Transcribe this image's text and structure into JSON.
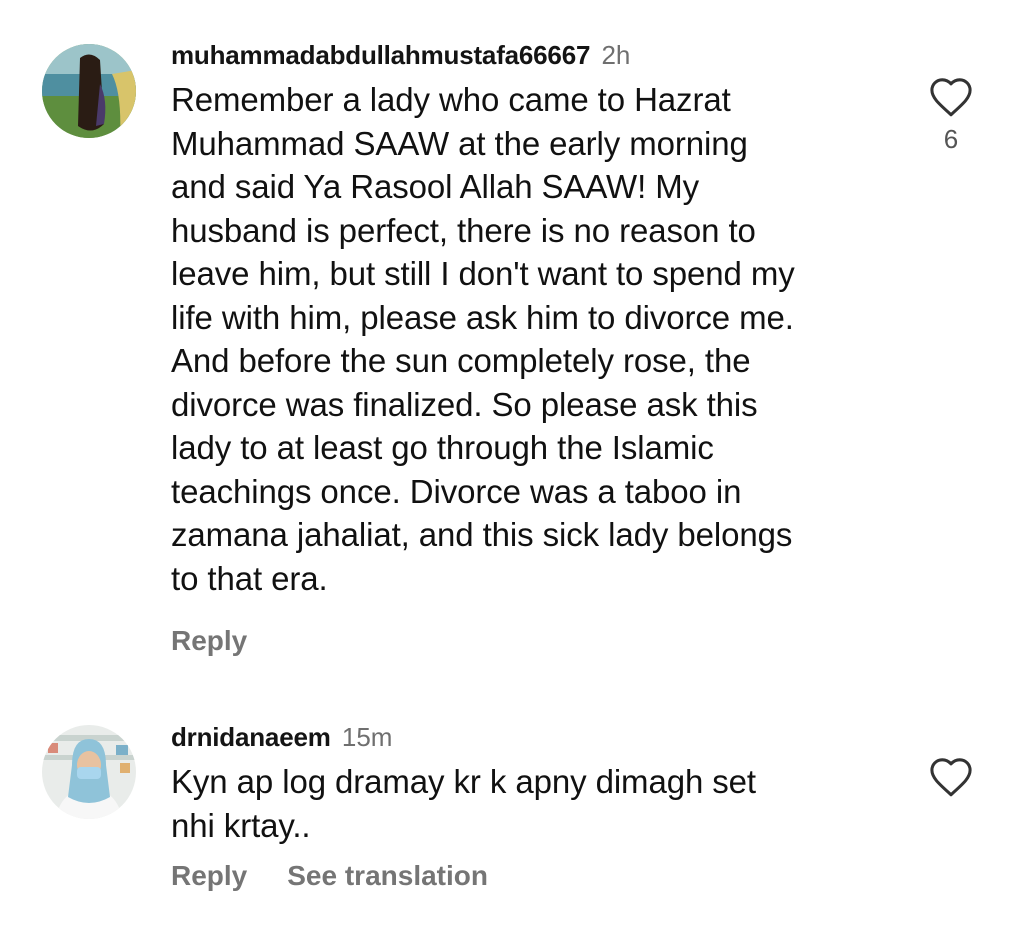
{
  "comments": [
    {
      "username": "muhammadabdullahmustafa66667",
      "time": "2h",
      "text": "Remember a lady who came to Hazrat\nMuhammad SAAW at the early morning\nand said Ya Rasool Allah SAAW! My\nhusband is perfect, there is no reason to\nleave him, but still I don't want to spend my\nlife with him, please ask him to divorce me.\nAnd before the sun completely rose, the\ndivorce was finalized. So please ask this\nlady to at least go through the Islamic\nteachings once. Divorce was a taboo in\nzamana jahaliat, and this sick lady belongs\nto that era.",
      "like_count": "6",
      "reply_label": "Reply",
      "like_icon": "heart-outline-icon"
    },
    {
      "username": "drnidanaeem",
      "time": "15m",
      "text": "Kyn ap log dramay kr k apny dimagh set\nnhi krtay..",
      "reply_label": "Reply",
      "translation_label": "See translation",
      "like_icon": "heart-outline-icon"
    }
  ],
  "colors": {
    "text": "#111111",
    "secondary_text": "#757575",
    "timestamp": "#6f6f6f",
    "background": "#ffffff"
  }
}
